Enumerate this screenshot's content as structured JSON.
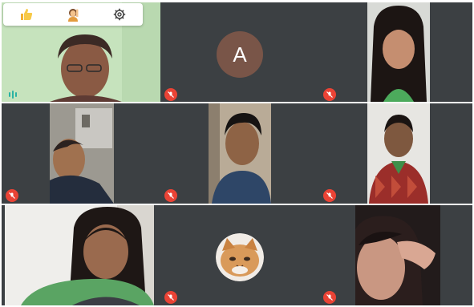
{
  "toolbar": {
    "icons": [
      "thumbs-up-icon",
      "raise-hand-icon",
      "settings-gear-icon"
    ]
  },
  "tiles": [
    {
      "id": "t1",
      "kind": "video",
      "status": "speaking"
    },
    {
      "id": "t2",
      "kind": "avatar",
      "avatar_letter": "A",
      "status": "muted"
    },
    {
      "id": "t3",
      "kind": "video",
      "status": "muted"
    },
    {
      "id": "t4",
      "kind": "video",
      "status": "muted"
    },
    {
      "id": "t5",
      "kind": "video",
      "status": "muted"
    },
    {
      "id": "t6",
      "kind": "video",
      "status": "muted"
    },
    {
      "id": "t7",
      "kind": "video",
      "status": "muted"
    },
    {
      "id": "t8",
      "kind": "profile-image",
      "status": "muted"
    },
    {
      "id": "t9",
      "kind": "video",
      "status": "muted"
    }
  ],
  "colors": {
    "tile_bg": "#3c4043",
    "mute_red": "#ea4335",
    "avatar_brown": "#795548",
    "speaking_teal": "#2bb3a3"
  }
}
